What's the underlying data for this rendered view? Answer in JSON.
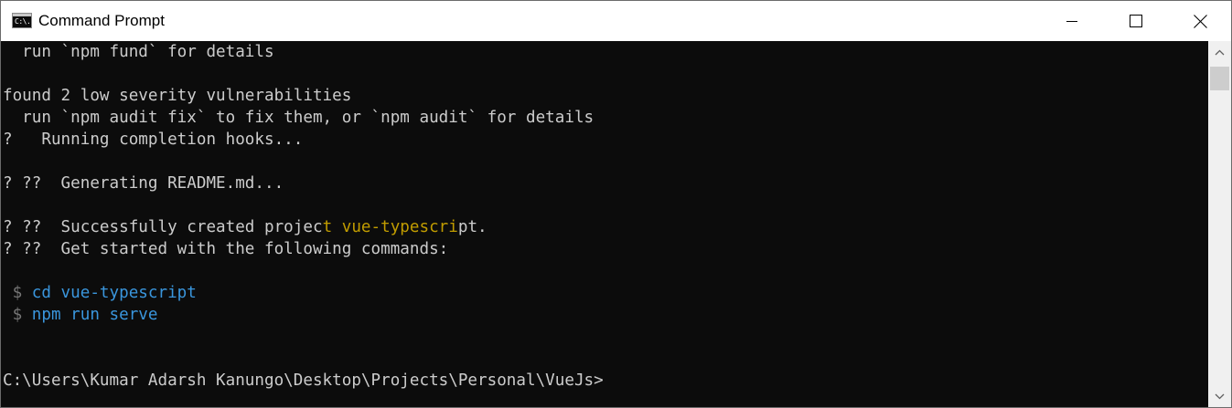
{
  "window": {
    "title": "Command Prompt",
    "icon_text": "C:\\."
  },
  "console": {
    "lines": [
      {
        "segments": [
          {
            "text": "  run `npm fund` for details",
            "color": "default"
          }
        ]
      },
      {
        "segments": [
          {
            "text": "",
            "color": "default"
          }
        ]
      },
      {
        "segments": [
          {
            "text": "found 2 low severity vulnerabilities",
            "color": "default"
          }
        ]
      },
      {
        "segments": [
          {
            "text": "  run `npm audit fix` to fix them, or `npm audit` for details",
            "color": "default"
          }
        ]
      },
      {
        "segments": [
          {
            "text": "?   Running completion hooks...",
            "color": "default"
          }
        ]
      },
      {
        "segments": [
          {
            "text": "",
            "color": "default"
          }
        ]
      },
      {
        "segments": [
          {
            "text": "? ??  Generating README.md...",
            "color": "default"
          }
        ]
      },
      {
        "segments": [
          {
            "text": "",
            "color": "default"
          }
        ]
      },
      {
        "segments": [
          {
            "text": "? ??  Successfully created projec",
            "color": "default"
          },
          {
            "text": "t vue-typescri",
            "color": "yellow"
          },
          {
            "text": "pt.",
            "color": "default"
          }
        ]
      },
      {
        "segments": [
          {
            "text": "? ??  Get started with the following commands:",
            "color": "default"
          }
        ]
      },
      {
        "segments": [
          {
            "text": "",
            "color": "default"
          }
        ]
      },
      {
        "segments": [
          {
            "text": " $ ",
            "color": "grey"
          },
          {
            "text": "cd vue-typescript",
            "color": "blue"
          }
        ]
      },
      {
        "segments": [
          {
            "text": " $ ",
            "color": "grey"
          },
          {
            "text": "npm run serve",
            "color": "blue"
          }
        ]
      },
      {
        "segments": [
          {
            "text": "",
            "color": "default"
          }
        ]
      },
      {
        "segments": [
          {
            "text": "",
            "color": "default"
          }
        ]
      },
      {
        "segments": [
          {
            "text": "C:\\Users\\Kumar Adarsh Kanungo\\Desktop\\Projects\\Personal\\VueJs>",
            "color": "default"
          }
        ]
      }
    ]
  },
  "colors": {
    "console_background": "#0c0c0c",
    "default_text": "#cccccc",
    "yellow": "#c19c00",
    "blue": "#3a96dd",
    "grey": "#767676",
    "titlebar": "#ffffff"
  },
  "icons": {
    "minimize": "minimize-icon",
    "maximize": "maximize-icon",
    "close": "close-icon",
    "scroll_up": "chevron-up-icon",
    "scroll_down": "chevron-down-icon"
  }
}
